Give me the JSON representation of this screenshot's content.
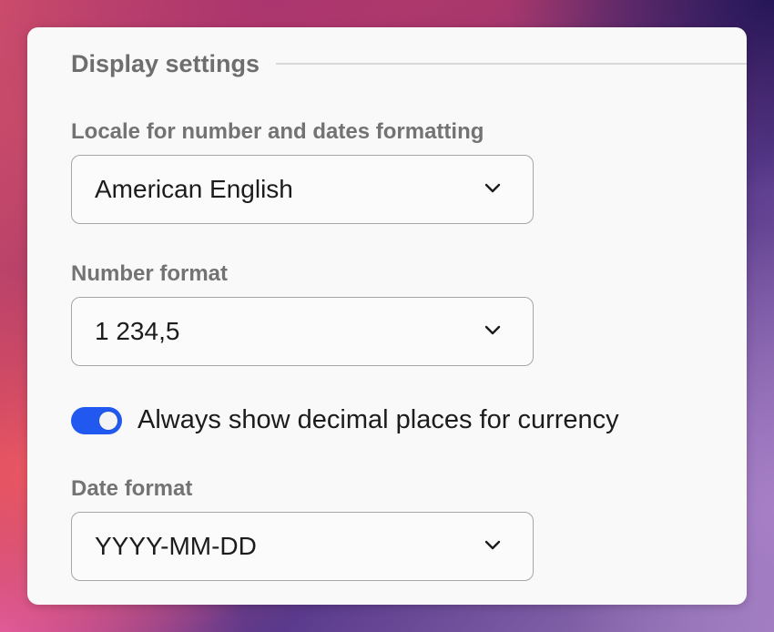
{
  "section": {
    "title": "Display settings"
  },
  "locale": {
    "label": "Locale for number and dates formatting",
    "value": "American English",
    "icon": "chevron-down-icon"
  },
  "number_format": {
    "label": "Number format",
    "value": "1 234,5",
    "icon": "chevron-down-icon"
  },
  "currency_toggle": {
    "label": "Always show decimal places for currency",
    "checked": true,
    "color": "#2159f0"
  },
  "date_format": {
    "label": "Date format",
    "value": "YYYY-MM-DD",
    "icon": "chevron-down-icon"
  }
}
